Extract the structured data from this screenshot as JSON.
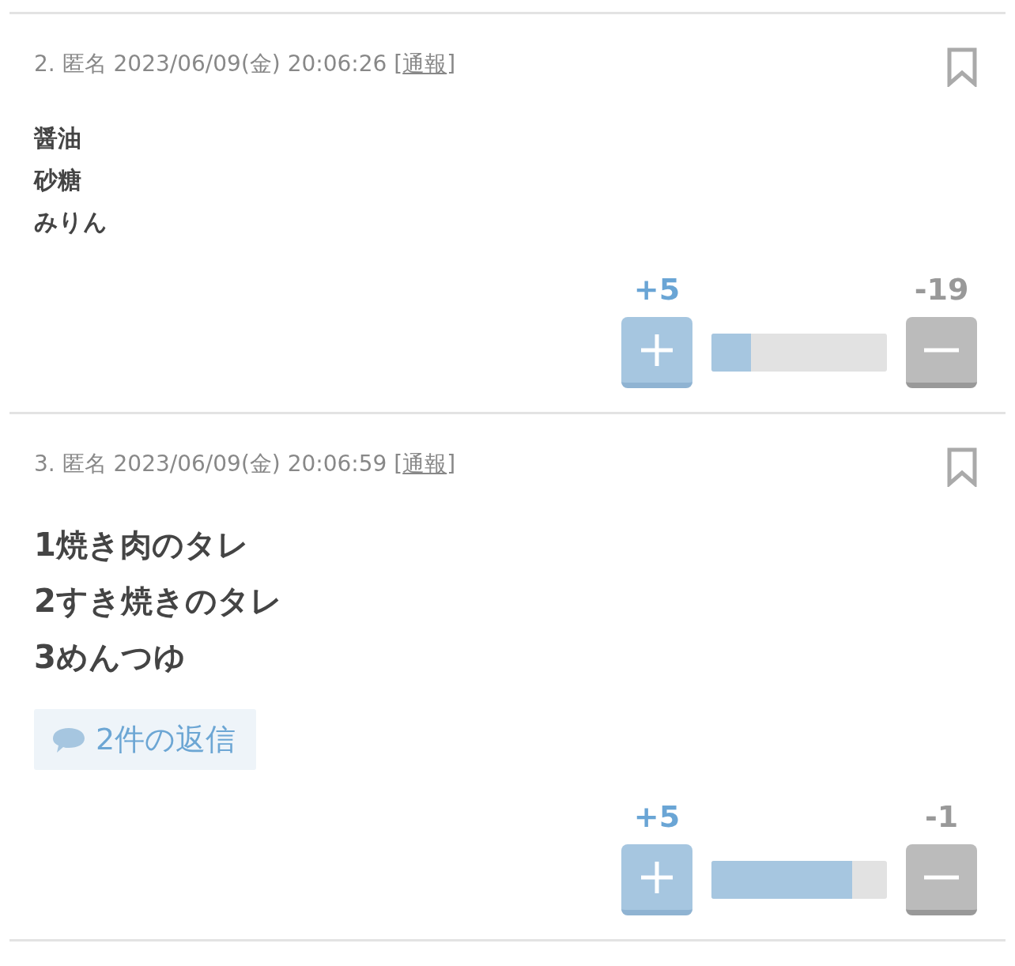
{
  "comments": [
    {
      "number": "2.",
      "author": "匿名",
      "date": "2023/06/09(金) 20:06:26",
      "report": {
        "open": "[",
        "link": "通報",
        "close": "]"
      },
      "kind": "plain",
      "lines": [
        "醤油",
        "砂糖",
        "みりん"
      ],
      "votes": {
        "plus": "+5",
        "minus": "-19",
        "level": 0.225
      }
    },
    {
      "number": "3.",
      "author": "匿名",
      "date": "2023/06/09(金) 20:06:59",
      "report": {
        "open": "[",
        "link": "通報",
        "close": "]"
      },
      "kind": "emphasized",
      "lines": [
        "1焼き肉のタレ",
        "2すき焼きのタレ",
        "3めんつゆ"
      ],
      "replies": "2件の返信",
      "votes": {
        "plus": "+5",
        "minus": "-1",
        "level": 0.8
      }
    }
  ]
}
